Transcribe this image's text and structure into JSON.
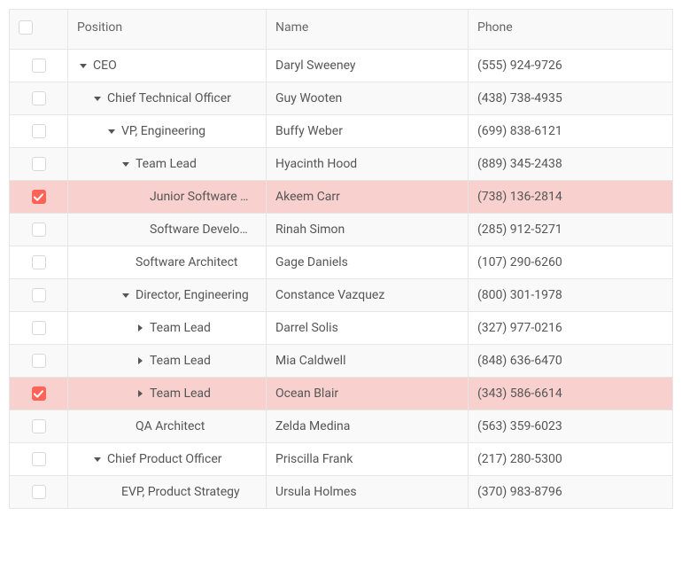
{
  "columns": {
    "position": "Position",
    "name": "Name",
    "phone": "Phone"
  },
  "rows": [
    {
      "position": "CEO",
      "name": "Daryl Sweeney",
      "phone": "(555) 924-9726",
      "level": 0,
      "expanded": true,
      "hasChildren": true,
      "selected": false,
      "alt": false
    },
    {
      "position": "Chief Technical Officer",
      "name": "Guy Wooten",
      "phone": "(438) 738-4935",
      "level": 1,
      "expanded": true,
      "hasChildren": true,
      "selected": false,
      "alt": true
    },
    {
      "position": "VP, Engineering",
      "name": "Buffy Weber",
      "phone": "(699) 838-6121",
      "level": 2,
      "expanded": true,
      "hasChildren": true,
      "selected": false,
      "alt": false
    },
    {
      "position": "Team Lead",
      "name": "Hyacinth Hood",
      "phone": "(889) 345-2438",
      "level": 3,
      "expanded": true,
      "hasChildren": true,
      "selected": false,
      "alt": true
    },
    {
      "position": "Junior Software …",
      "name": "Akeem Carr",
      "phone": "(738) 136-2814",
      "level": 4,
      "expanded": null,
      "hasChildren": false,
      "selected": true,
      "alt": false
    },
    {
      "position": "Software Develo…",
      "name": "Rinah Simon",
      "phone": "(285) 912-5271",
      "level": 4,
      "expanded": null,
      "hasChildren": false,
      "selected": false,
      "alt": true
    },
    {
      "position": "Software Architect",
      "name": "Gage Daniels",
      "phone": "(107) 290-6260",
      "level": 3,
      "expanded": null,
      "hasChildren": false,
      "selected": false,
      "alt": false
    },
    {
      "position": "Director, Engineering",
      "name": "Constance Vazquez",
      "phone": "(800) 301-1978",
      "level": 3,
      "expanded": true,
      "hasChildren": true,
      "selected": false,
      "alt": true
    },
    {
      "position": "Team Lead",
      "name": "Darrel Solis",
      "phone": "(327) 977-0216",
      "level": 4,
      "expanded": false,
      "hasChildren": true,
      "selected": false,
      "alt": false
    },
    {
      "position": "Team Lead",
      "name": "Mia Caldwell",
      "phone": "(848) 636-6470",
      "level": 4,
      "expanded": false,
      "hasChildren": true,
      "selected": false,
      "alt": true
    },
    {
      "position": "Team Lead",
      "name": "Ocean Blair",
      "phone": "(343) 586-6614",
      "level": 4,
      "expanded": false,
      "hasChildren": true,
      "selected": true,
      "alt": false
    },
    {
      "position": "QA Architect",
      "name": "Zelda Medina",
      "phone": "(563) 359-6023",
      "level": 3,
      "expanded": null,
      "hasChildren": false,
      "selected": false,
      "alt": true
    },
    {
      "position": "Chief Product Officer",
      "name": "Priscilla Frank",
      "phone": "(217) 280-5300",
      "level": 1,
      "expanded": true,
      "hasChildren": true,
      "selected": false,
      "alt": false
    },
    {
      "position": "EVP, Product Strategy",
      "name": "Ursula Holmes",
      "phone": "(370) 983-8796",
      "level": 2,
      "expanded": null,
      "hasChildren": false,
      "selected": false,
      "alt": true
    }
  ],
  "indentPx": 16
}
